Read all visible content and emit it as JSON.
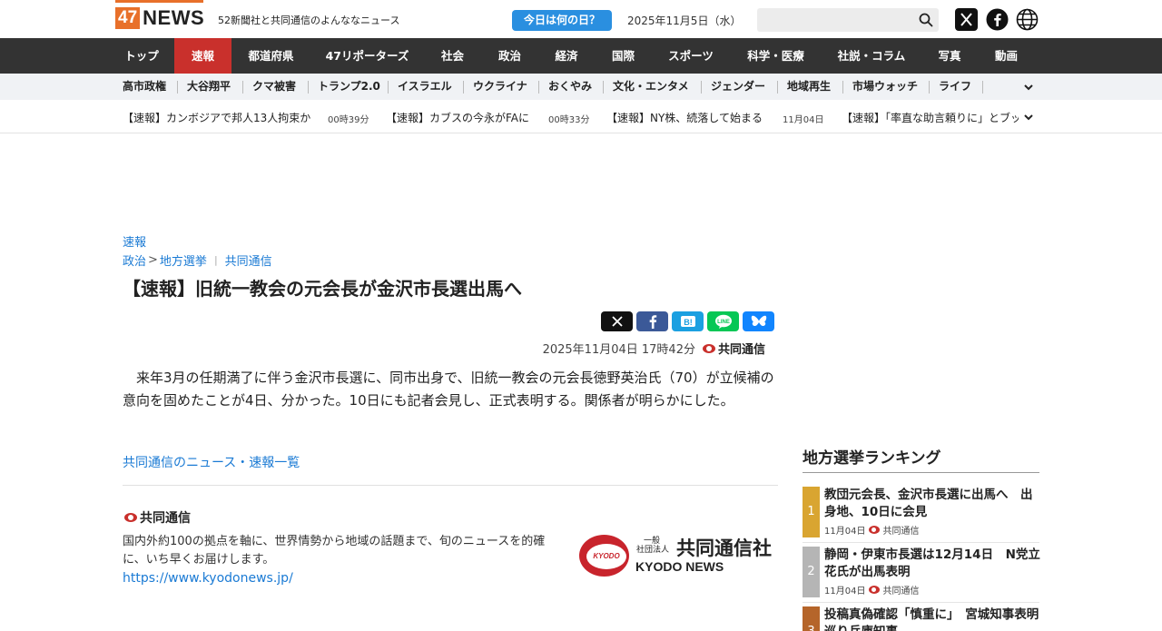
{
  "header": {
    "logo_num": "47",
    "logo_text": "NEWS",
    "tagline": "52新聞社と共同通信のよんななニュース",
    "today_button": "今日は何の日？",
    "date": "2025年11月5日（水）",
    "search_placeholder": ""
  },
  "main_nav": [
    {
      "label": "トップ"
    },
    {
      "label": "速報"
    },
    {
      "label": "都道府県"
    },
    {
      "label": "47リポーターズ"
    },
    {
      "label": "社会"
    },
    {
      "label": "政治"
    },
    {
      "label": "経済"
    },
    {
      "label": "国際"
    },
    {
      "label": "スポーツ"
    },
    {
      "label": "科学・医療"
    },
    {
      "label": "社説・コラム"
    },
    {
      "label": "写真"
    },
    {
      "label": "動画"
    }
  ],
  "sub_nav": [
    {
      "label": "高市政権"
    },
    {
      "label": "大谷翔平"
    },
    {
      "label": "クマ被害"
    },
    {
      "label": "トランプ2.0"
    },
    {
      "label": "イスラエル"
    },
    {
      "label": "ウクライナ"
    },
    {
      "label": "おくやみ"
    },
    {
      "label": "文化・エンタメ"
    },
    {
      "label": "ジェンダー"
    },
    {
      "label": "地域再生"
    },
    {
      "label": "市場ウォッチ"
    },
    {
      "label": "ライフ"
    }
  ],
  "ticker": [
    {
      "title": "【速報】カンボジアで邦人13人拘束か",
      "time": "00時39分"
    },
    {
      "title": "【速報】カブスの今永がFAに",
      "time": "00時33分"
    },
    {
      "title": "【速報】NY株、続落して始まる",
      "time": "11月04日"
    },
    {
      "title": "【速報】「率直な助言頼りに」とブッ",
      "time": ""
    }
  ],
  "article": {
    "category": "速報",
    "breadcrumb": {
      "parent": "政治",
      "sep": ">",
      "child": "地方選挙",
      "provider": "共同通信"
    },
    "title": "【速報】旧統一教会の元会長が金沢市長選出馬へ",
    "datetime": "2025年11月04日 17時42分",
    "source": "共同通信",
    "body": "来年3月の任期満了に伴う金沢市長選に、同市出身で、旧統一教会の元会長徳野英治氏（70）が立候補の意向を固めたことが4日、分かった。10日にも記者会見し、正式表明する。関係者が明らかにした。",
    "list_link": "共同通信のニュース・速報一覧"
  },
  "provider": {
    "name": "共同通信",
    "description": "国内外約100の拠点を軸に、世界情勢から地域の話題まで、旬のニュースを的確に、いち早くお届けします。",
    "url": "https://www.kyodonews.jp/",
    "logo_small_1": "一般",
    "logo_small_2": "社団法人",
    "logo_jp": "共同通信社",
    "logo_en": "KYODO NEWS",
    "logo_circle": "KYODO"
  },
  "sidebar": {
    "title": "地方選挙ランキング",
    "items": [
      {
        "rank": "1",
        "title": "教団元会長、金沢市長選に出馬へ　出身地、10日に会見",
        "date": "11月04日",
        "source": "共同通信",
        "color": "#d9a531"
      },
      {
        "rank": "2",
        "title": "静岡・伊東市長選は12月14日　N党立花氏が出馬表明",
        "date": "11月04日",
        "source": "共同通信",
        "color": "#b5b5b5"
      },
      {
        "rank": "3",
        "title": "投稿真偽確認「慎重に」　宮城知事表明巡り兵庫知事",
        "date": "",
        "source": "",
        "color": "#b5652a"
      }
    ]
  },
  "colors": {
    "accent_orange": "#e8702a",
    "nav_dark": "#333333",
    "nav_active": "#c9302c",
    "link_blue": "#1a7ad4",
    "today_blue": "#2a8fe0"
  }
}
